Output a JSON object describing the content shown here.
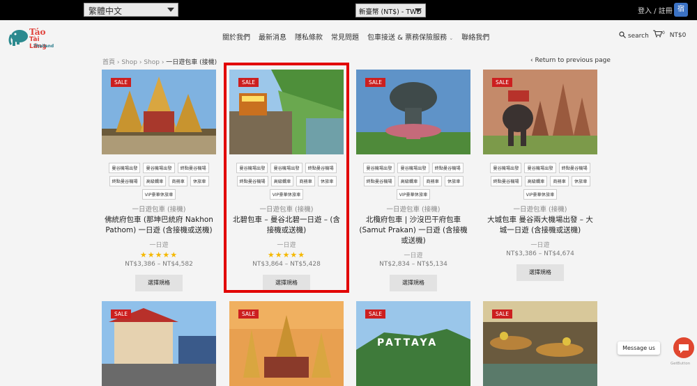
{
  "topbar": {
    "language": "繁體中文",
    "currency": "新臺幣 (NT$) - TWD",
    "login": "登入 / 註冊",
    "badge": "宿"
  },
  "header": {
    "logo": {
      "line1": "Táo",
      "line2": "Tài Lăng",
      "line3": "Thailand"
    },
    "nav": [
      "關於我們",
      "最新消息",
      "隱私條款",
      "常見問題",
      "包車接送 & 票務保險服務",
      "聯絡我們"
    ],
    "search": "search",
    "cart_count": "0",
    "cart_total": "NT$0"
  },
  "breadcrumb": {
    "home": "首頁",
    "shop1": "Shop",
    "shop2": "Shop",
    "current": "一日遊包車 (接機)"
  },
  "return_link": "Return to previous page",
  "sale_label": "SALE",
  "products": [
    {
      "tags": [
        "曼谷機場出發",
        "曼谷機場出發",
        "終點曼谷機場",
        "終點曼谷機場",
        "高級轎車",
        "商務車",
        "休旅車",
        "VIP豪華休旅車"
      ],
      "category": "一日遊包車 (接機)",
      "title": "佛統府包車 (那坤巴統府 Nakhon Pathom) 一日遊 (含接機或送機)",
      "subtitle": "一日遊",
      "stars": "★★★★★",
      "price": "NT$3,386 – NT$4,582",
      "button": "選擇規格"
    },
    {
      "tags": [
        "曼谷機場出發",
        "曼谷機場出發",
        "終點曼谷機場",
        "終點曼谷機場",
        "高級轎車",
        "商務車",
        "休旅車",
        "VIP豪華休旅車"
      ],
      "category": "一日遊包車 (接機)",
      "title": "北碧包車 – 曼谷北碧一日遊 – (含接機或送機)",
      "subtitle": "一日遊",
      "stars": "★★★★★",
      "price": "NT$3,864 – NT$5,428",
      "button": "選擇規格"
    },
    {
      "tags": [
        "曼谷機場出發",
        "曼谷機場出發",
        "終點曼谷機場",
        "終點曼谷機場",
        "高級轎車",
        "商務車",
        "休旅車",
        "VIP豪華休旅車"
      ],
      "category": "一日遊包車 (接機)",
      "title": "北欖府包車 | 沙沒巴干府包車 (Samut Prakan) 一日遊 (含接機或送機)",
      "subtitle": "一日遊",
      "stars": "",
      "price": "NT$2,834 – NT$5,134",
      "button": "選擇規格"
    },
    {
      "tags": [
        "曼谷機場出發",
        "曼谷機場出發",
        "終點曼谷機場",
        "終點曼谷機場",
        "高級轎車",
        "商務車",
        "休旅車",
        "VIP豪華休旅車"
      ],
      "category": "一日遊包車 (接機)",
      "title": "大城包車 曼谷兩大機場出發 – 大城一日遊 (含接機或送機)",
      "subtitle": "一日遊",
      "stars": "",
      "price": "NT$3,386 – NT$4,674",
      "button": "選擇規格"
    }
  ],
  "chat": {
    "message": "Message us",
    "brand": "GetButton"
  }
}
